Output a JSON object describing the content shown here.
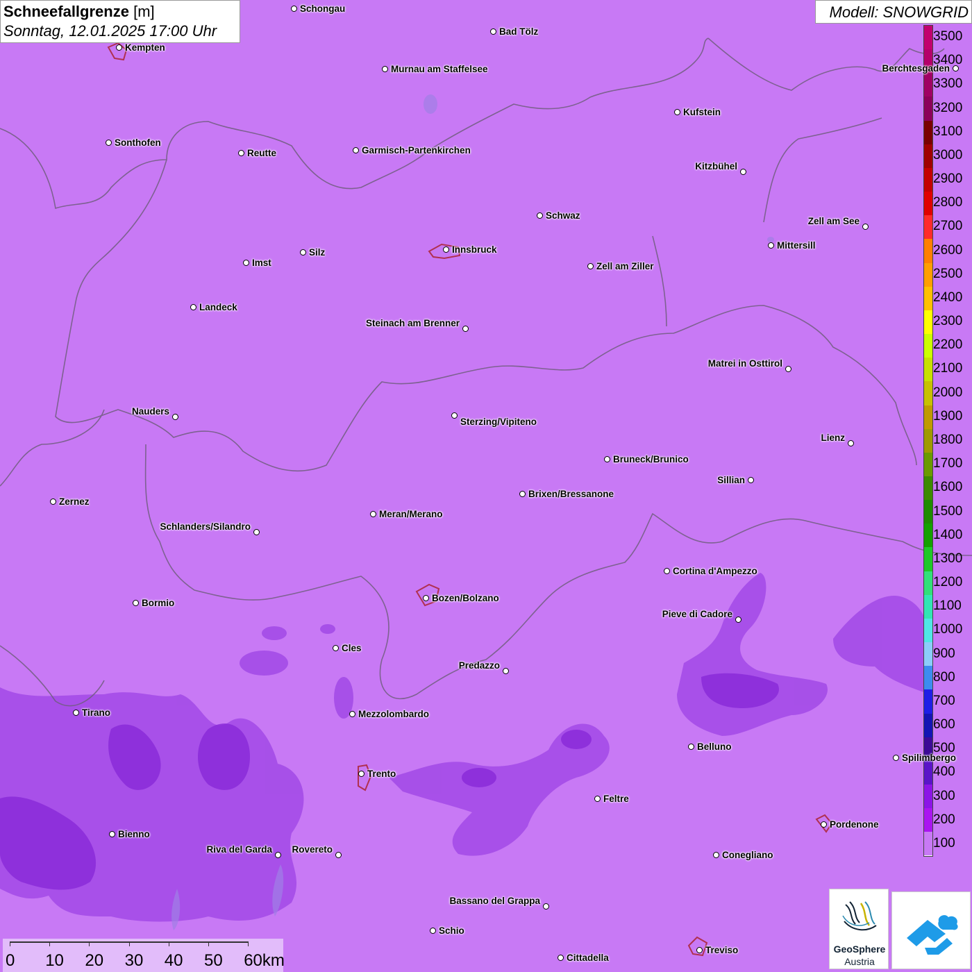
{
  "header": {
    "title_bold": "Schneefallgrenze",
    "title_unit": "[m]",
    "datetime": "Sonntag, 12.01.2025 17:00 Uhr"
  },
  "model": {
    "label": "Modell: SNOWGRID"
  },
  "legend": {
    "labels": [
      "3500",
      "3400",
      "3300",
      "3200",
      "3100",
      "3000",
      "2900",
      "2800",
      "2700",
      "2600",
      "2500",
      "2400",
      "2300",
      "2200",
      "2100",
      "2000",
      "1900",
      "1800",
      "1700",
      "1600",
      "1500",
      "1400",
      "1300",
      "1200",
      "1100",
      "1000",
      "900",
      "800",
      "700",
      "600",
      "500",
      "400",
      "300",
      "200",
      "100"
    ],
    "colors": [
      "#c2006e",
      "#b5006a",
      "#a00064",
      "#8c005a",
      "#7a0000",
      "#a00000",
      "#c40000",
      "#e00000",
      "#ff2a2a",
      "#ff7f00",
      "#ff9e00",
      "#ffbf00",
      "#ffff00",
      "#ccff00",
      "#c8e000",
      "#c8c000",
      "#c09a00",
      "#a09a00",
      "#6a9a00",
      "#3c8a00",
      "#1e8c00",
      "#14a000",
      "#1ec828",
      "#32e07a",
      "#32e6b4",
      "#50e6e6",
      "#8ccdfa",
      "#3c8cf0",
      "#1e1ee6",
      "#1414b4",
      "#3c0a96",
      "#5a14c8",
      "#8c14e6",
      "#aa14f0",
      "#c879f5"
    ]
  },
  "cities": [
    {
      "name": "Schongau"
    },
    {
      "name": "Bad Tölz"
    },
    {
      "name": "Kempten"
    },
    {
      "name": "Murnau am Staffelsee"
    },
    {
      "name": "Berchtesgaden"
    },
    {
      "name": "Kufstein"
    },
    {
      "name": "Sonthofen"
    },
    {
      "name": "Reutte"
    },
    {
      "name": "Garmisch-Partenkirchen"
    },
    {
      "name": "Kitzbühel"
    },
    {
      "name": "Schwaz"
    },
    {
      "name": "Zell am See"
    },
    {
      "name": "Mittersill"
    },
    {
      "name": "Innsbruck"
    },
    {
      "name": "Imst"
    },
    {
      "name": "Silz"
    },
    {
      "name": "Zell am Ziller"
    },
    {
      "name": "Landeck"
    },
    {
      "name": "Steinach am Brenner"
    },
    {
      "name": "Matrei in Osttirol"
    },
    {
      "name": "Nauders"
    },
    {
      "name": "Sterzing/Vipiteno"
    },
    {
      "name": "Lienz"
    },
    {
      "name": "Bruneck/Brunico"
    },
    {
      "name": "Sillian"
    },
    {
      "name": "Zernez"
    },
    {
      "name": "Brixen/Bressanone"
    },
    {
      "name": "Meran/Merano"
    },
    {
      "name": "Schlanders/Silandro"
    },
    {
      "name": "Cortina d'Ampezzo"
    },
    {
      "name": "Bozen/Bolzano"
    },
    {
      "name": "Bormio"
    },
    {
      "name": "Pieve di Cadore"
    },
    {
      "name": "Cles"
    },
    {
      "name": "Predazzo"
    },
    {
      "name": "Tirano"
    },
    {
      "name": "Mezzolombardo"
    },
    {
      "name": "Belluno"
    },
    {
      "name": "Spilimbergo"
    },
    {
      "name": "Trento"
    },
    {
      "name": "Feltre"
    },
    {
      "name": "Pordenone"
    },
    {
      "name": "Bienno"
    },
    {
      "name": "Riva del Garda"
    },
    {
      "name": "Rovereto"
    },
    {
      "name": "Conegliano"
    },
    {
      "name": "Bassano del Grappa"
    },
    {
      "name": "Schio"
    },
    {
      "name": "Treviso"
    },
    {
      "name": "Cittadella"
    }
  ],
  "scale": {
    "labels": [
      "0",
      "10",
      "20",
      "30",
      "40",
      "50",
      "60km"
    ]
  },
  "logos": {
    "geosphere_line1": "GeoSphere",
    "geosphere_line2": "Austria"
  }
}
